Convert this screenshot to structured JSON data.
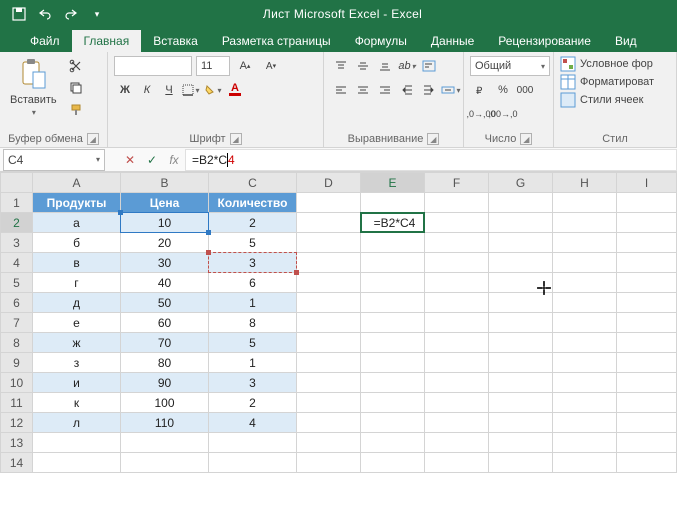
{
  "title": "Лист Microsoft Excel  -  Excel",
  "tabs": [
    "Файл",
    "Главная",
    "Вставка",
    "Разметка страницы",
    "Формулы",
    "Данные",
    "Рецензирование",
    "Вид"
  ],
  "active_tab_index": 1,
  "ribbon": {
    "clipboard": {
      "paste": "Вставить",
      "label": "Буфер обмена"
    },
    "font": {
      "name": "",
      "size": "11",
      "label": "Шрифт",
      "bold": "Ж",
      "italic": "К",
      "underline": "Ч"
    },
    "alignment": {
      "label": "Выравнивание"
    },
    "number": {
      "format": "Общий",
      "label": "Число"
    },
    "styles": {
      "cond": "Условное фор",
      "fmt": "Форматироват",
      "cell": "Стили ячеек",
      "label": "Стил"
    }
  },
  "namebox": "C4",
  "formula": "=B2*C4",
  "formula_disp_prefix": "=B2*C",
  "formula_disp_suffix": "4",
  "cols": [
    "A",
    "B",
    "C",
    "D",
    "E",
    "F",
    "G",
    "H",
    "I"
  ],
  "headers": [
    "Продукты",
    "Цена",
    "Количество"
  ],
  "rows": [
    {
      "n": 1
    },
    {
      "n": 2,
      "a": "а",
      "b": "10",
      "c": "2",
      "e": "=B2*C4"
    },
    {
      "n": 3,
      "a": "б",
      "b": "20",
      "c": "5"
    },
    {
      "n": 4,
      "a": "в",
      "b": "30",
      "c": "3"
    },
    {
      "n": 5,
      "a": "г",
      "b": "40",
      "c": "6"
    },
    {
      "n": 6,
      "a": "д",
      "b": "50",
      "c": "1"
    },
    {
      "n": 7,
      "a": "е",
      "b": "60",
      "c": "8"
    },
    {
      "n": 8,
      "a": "ж",
      "b": "70",
      "c": "5"
    },
    {
      "n": 9,
      "a": "з",
      "b": "80",
      "c": "1"
    },
    {
      "n": 10,
      "a": "и",
      "b": "90",
      "c": "3"
    },
    {
      "n": 11,
      "a": "к",
      "b": "100",
      "c": "2"
    },
    {
      "n": 12,
      "a": "л",
      "b": "110",
      "c": "4"
    },
    {
      "n": 13
    },
    {
      "n": 14
    }
  ],
  "chart_data": {
    "type": "table",
    "title": "",
    "columns": [
      "Продукты",
      "Цена",
      "Количество"
    ],
    "data": [
      [
        "а",
        10,
        2
      ],
      [
        "б",
        20,
        5
      ],
      [
        "в",
        30,
        3
      ],
      [
        "г",
        40,
        6
      ],
      [
        "д",
        50,
        1
      ],
      [
        "е",
        60,
        8
      ],
      [
        "ж",
        70,
        5
      ],
      [
        "з",
        80,
        1
      ],
      [
        "и",
        90,
        3
      ],
      [
        "к",
        100,
        2
      ],
      [
        "л",
        110,
        4
      ]
    ],
    "active_cell": "E2",
    "active_formula": "=B2*C4",
    "referenced_cells": [
      "B2",
      "C4"
    ],
    "name_box": "C4"
  }
}
